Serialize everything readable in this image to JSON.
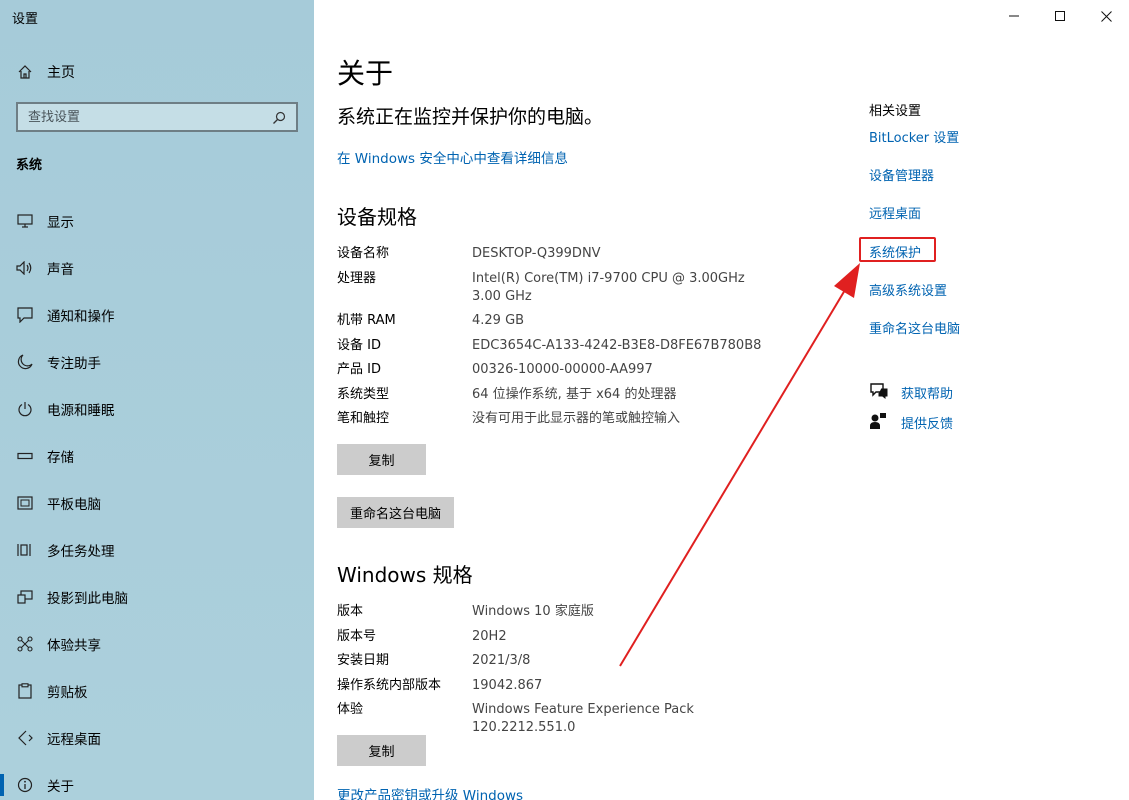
{
  "window": {
    "title": "设置"
  },
  "sidebar": {
    "home_label": "主页",
    "search_placeholder": "查找设置",
    "section": "系统",
    "items": [
      {
        "label": "显示",
        "icon": "monitor-icon"
      },
      {
        "label": "声音",
        "icon": "speaker-icon"
      },
      {
        "label": "通知和操作",
        "icon": "notification-icon"
      },
      {
        "label": "专注助手",
        "icon": "moon-icon"
      },
      {
        "label": "电源和睡眠",
        "icon": "power-icon"
      },
      {
        "label": "存储",
        "icon": "storage-icon"
      },
      {
        "label": "平板电脑",
        "icon": "tablet-icon"
      },
      {
        "label": "多任务处理",
        "icon": "multitask-icon"
      },
      {
        "label": "投影到此电脑",
        "icon": "project-icon"
      },
      {
        "label": "体验共享",
        "icon": "share-icon"
      },
      {
        "label": "剪贴板",
        "icon": "clipboard-icon"
      },
      {
        "label": "远程桌面",
        "icon": "remote-icon"
      },
      {
        "label": "关于",
        "icon": "info-icon",
        "active": true
      }
    ]
  },
  "main": {
    "title": "关于",
    "protection_text": "系统正在监控并保护你的电脑。",
    "security_link": "在 Windows 安全中心中查看详细信息",
    "device_specs": {
      "heading": "设备规格",
      "rows": [
        {
          "key": "设备名称",
          "value": "DESKTOP-Q399DNV"
        },
        {
          "key": "处理器",
          "value": "Intel(R) Core(TM) i7-9700 CPU @ 3.00GHz   3.00 GHz"
        },
        {
          "key": "机带 RAM",
          "value": "4.29 GB"
        },
        {
          "key": "设备 ID",
          "value": "EDC3654C-A133-4242-B3E8-D8FE67B780B8"
        },
        {
          "key": "产品 ID",
          "value": "00326-10000-00000-AA997"
        },
        {
          "key": "系统类型",
          "value": "64 位操作系统, 基于 x64 的处理器"
        },
        {
          "key": "笔和触控",
          "value": "没有可用于此显示器的笔或触控输入"
        }
      ],
      "copy_button": "复制",
      "rename_button": "重命名这台电脑"
    },
    "windows_specs": {
      "heading": "Windows 规格",
      "rows": [
        {
          "key": "版本",
          "value": "Windows 10 家庭版"
        },
        {
          "key": "版本号",
          "value": "20H2"
        },
        {
          "key": "安装日期",
          "value": "2021/3/8"
        },
        {
          "key": "操作系统内部版本",
          "value": "19042.867"
        },
        {
          "key": "体验",
          "value": "Windows Feature Experience Pack 120.2212.551.0"
        }
      ],
      "copy_button": "复制",
      "upgrade_link": "更改产品密钥或升级 Windows"
    }
  },
  "related": {
    "heading": "相关设置",
    "links": [
      "BitLocker 设置",
      "设备管理器",
      "远程桌面",
      "系统保护",
      "高级系统设置",
      "重命名这台电脑"
    ],
    "help_label": "获取帮助",
    "feedback_label": "提供反馈"
  },
  "colors": {
    "sidebar_bg": "#a9cfdc",
    "link": "#0063b1",
    "annotation": "#e02020",
    "button_bg": "#cccccc"
  }
}
